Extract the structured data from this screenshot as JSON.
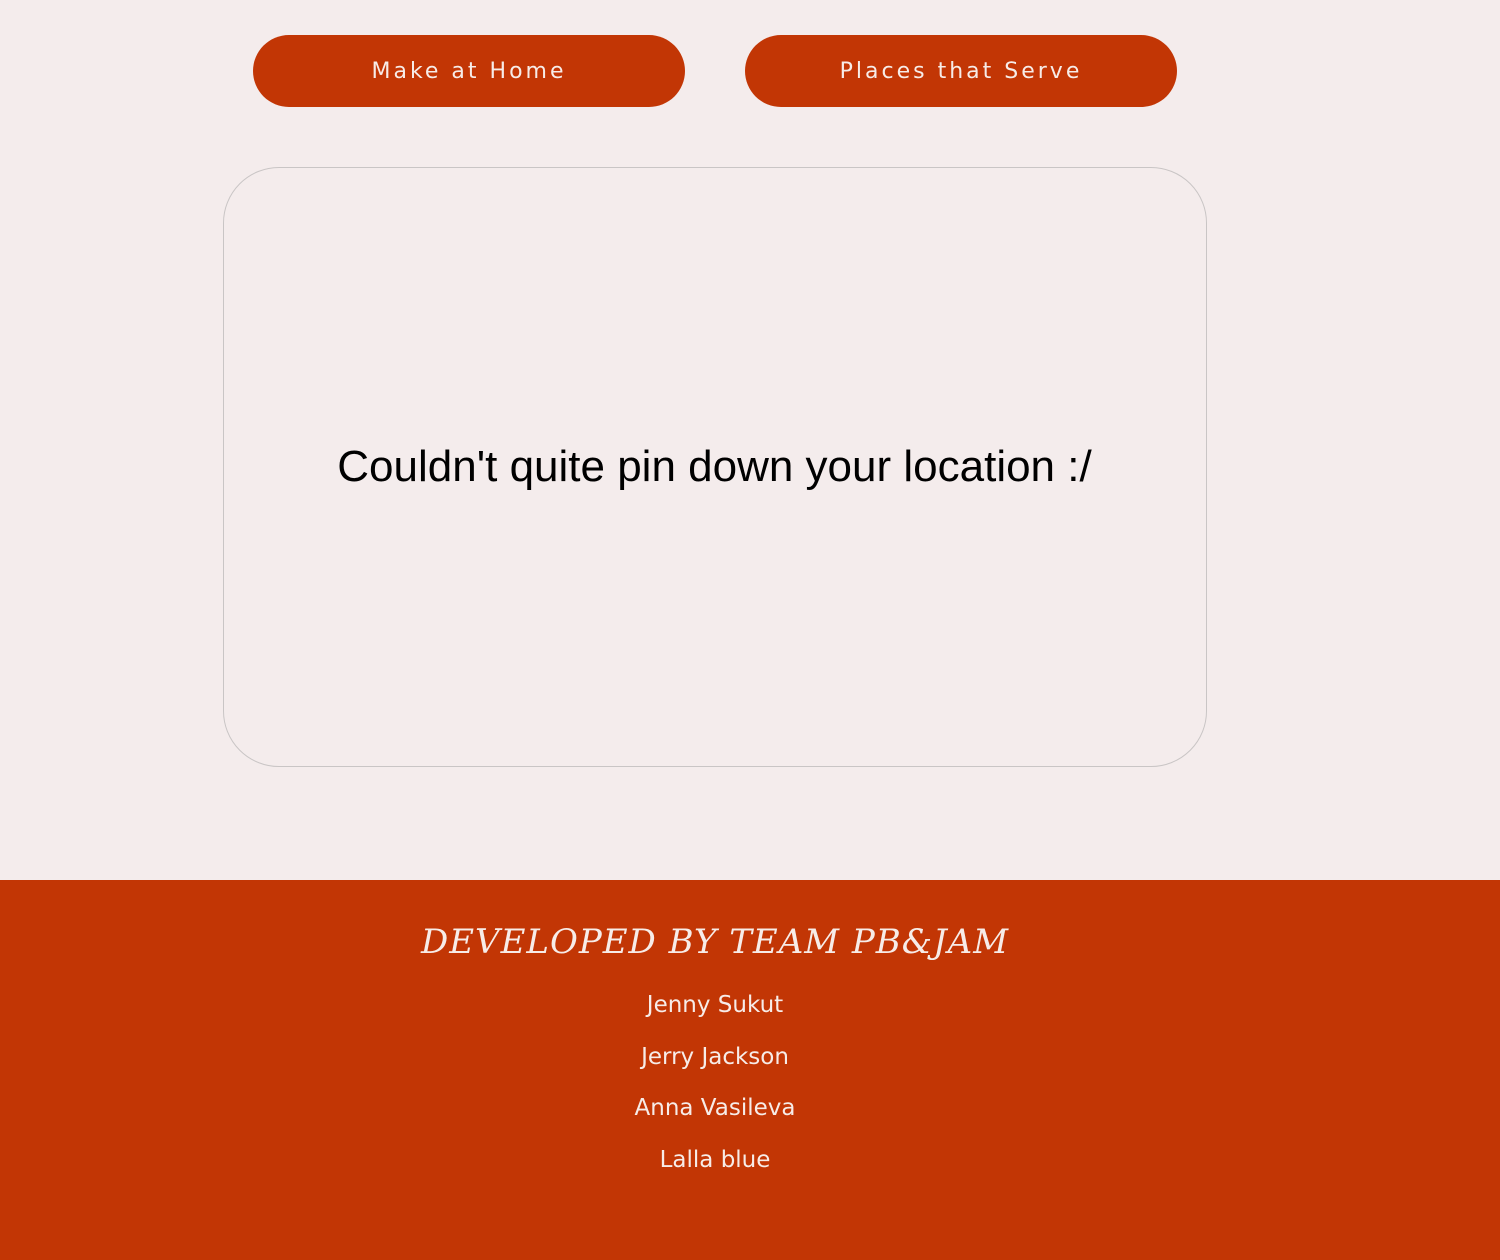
{
  "nav": {
    "make_at_home": "Make at Home",
    "places_that_serve": "Places that Serve"
  },
  "map": {
    "message": "Couldn't quite pin down your location :/"
  },
  "footer": {
    "title": "DEVELOPED BY TEAM PB&JAM",
    "members": [
      "Jenny Sukut",
      "Jerry Jackson",
      "Anna Vasileva",
      "Lalla blue"
    ]
  },
  "colors": {
    "accent": "#c23605",
    "background": "#f4ecec",
    "button_text": "#f7ece8"
  }
}
